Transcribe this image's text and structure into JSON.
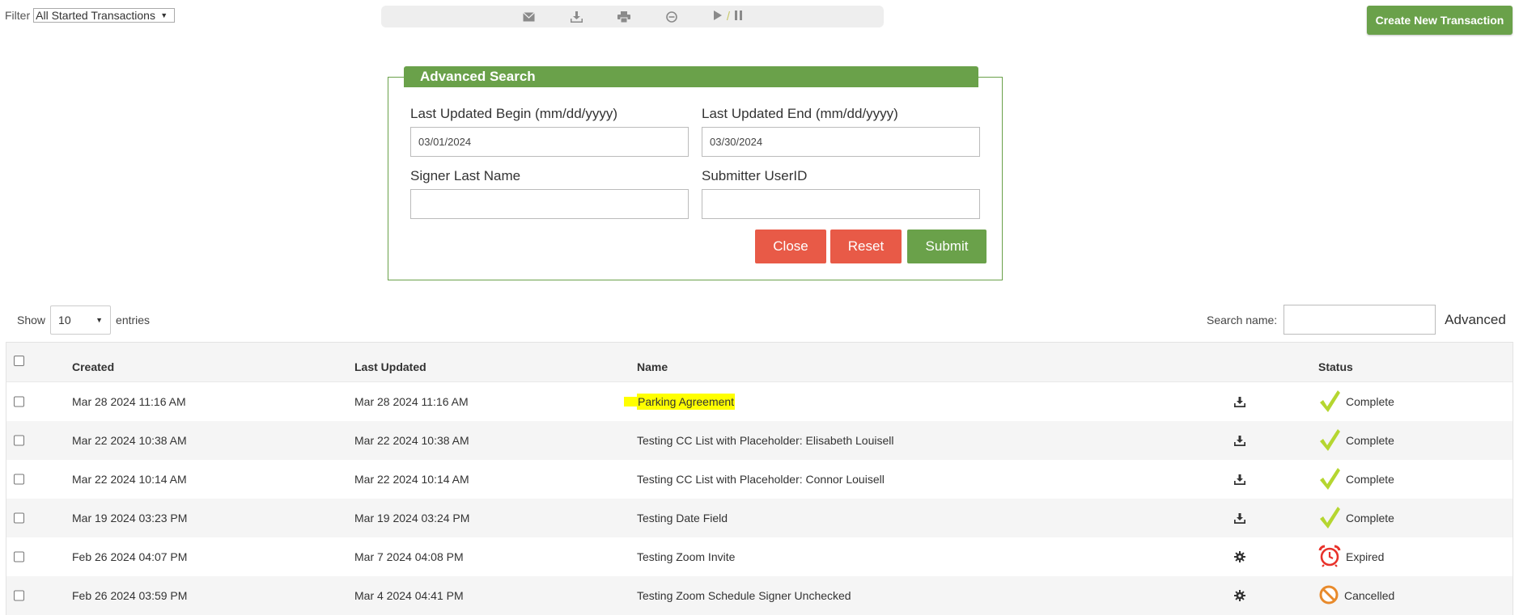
{
  "filter": {
    "label": "Filter",
    "selected": "All Started Transactions"
  },
  "toolbar": {
    "icons": [
      "email-icon",
      "download-icon",
      "print-icon",
      "cancel-icon",
      "play-icon",
      "pause-icon"
    ],
    "separator": "/"
  },
  "create_button": "Create New Transaction",
  "advanced_search": {
    "title": "Advanced Search",
    "begin_label": "Last Updated Begin (mm/dd/yyyy)",
    "begin_value": "03/01/2024",
    "end_label": "Last Updated End (mm/dd/yyyy)",
    "end_value": "03/30/2024",
    "signer_label": "Signer Last Name",
    "signer_value": "",
    "submitter_label": "Submitter UserID",
    "submitter_value": "",
    "close_label": "Close",
    "reset_label": "Reset",
    "submit_label": "Submit"
  },
  "entries": {
    "show_label": "Show",
    "value": "10",
    "suffix": "entries"
  },
  "search": {
    "label": "Search name:",
    "value": "",
    "advanced_link": "Advanced"
  },
  "table": {
    "headers": {
      "created": "Created",
      "updated": "Last Updated",
      "name": "Name",
      "status": "Status"
    },
    "rows": [
      {
        "created": "Mar 28 2024 11:16 AM",
        "updated": "Mar 28 2024 11:16 AM",
        "name": "Parking Agreement",
        "action": "download-icon",
        "status": "Complete",
        "status_icon": "check-icon"
      },
      {
        "created": "Mar 22 2024 10:38 AM",
        "updated": "Mar 22 2024 10:38 AM",
        "name": "Testing CC List with Placeholder: Elisabeth Louisell",
        "action": "download-icon",
        "status": "Complete",
        "status_icon": "check-icon"
      },
      {
        "created": "Mar 22 2024 10:14 AM",
        "updated": "Mar 22 2024 10:14 AM",
        "name": "Testing CC List with Placeholder: Connor Louisell",
        "action": "download-icon",
        "status": "Complete",
        "status_icon": "check-icon"
      },
      {
        "created": "Mar 19 2024 03:23 PM",
        "updated": "Mar 19 2024 03:24 PM",
        "name": "Testing Date Field",
        "action": "download-icon",
        "status": "Complete",
        "status_icon": "check-icon"
      },
      {
        "created": "Feb 26 2024 04:07 PM",
        "updated": "Mar 7 2024 04:08 PM",
        "name": "Testing Zoom Invite",
        "action": "gear-icon",
        "status": "Expired",
        "status_icon": "alarm-clock-icon"
      },
      {
        "created": "Feb 26 2024 03:59 PM",
        "updated": "Mar 4 2024 04:41 PM",
        "name": "Testing Zoom Schedule Signer Unchecked",
        "action": "gear-icon",
        "status": "Cancelled",
        "status_icon": "cancelled-icon"
      }
    ]
  },
  "colors": {
    "green": "#6aa14a",
    "red": "#e85a47",
    "check": "#b5d630",
    "expired": "#e8322b",
    "cancelled": "#e88a2b",
    "highlight": "#ffff00"
  }
}
